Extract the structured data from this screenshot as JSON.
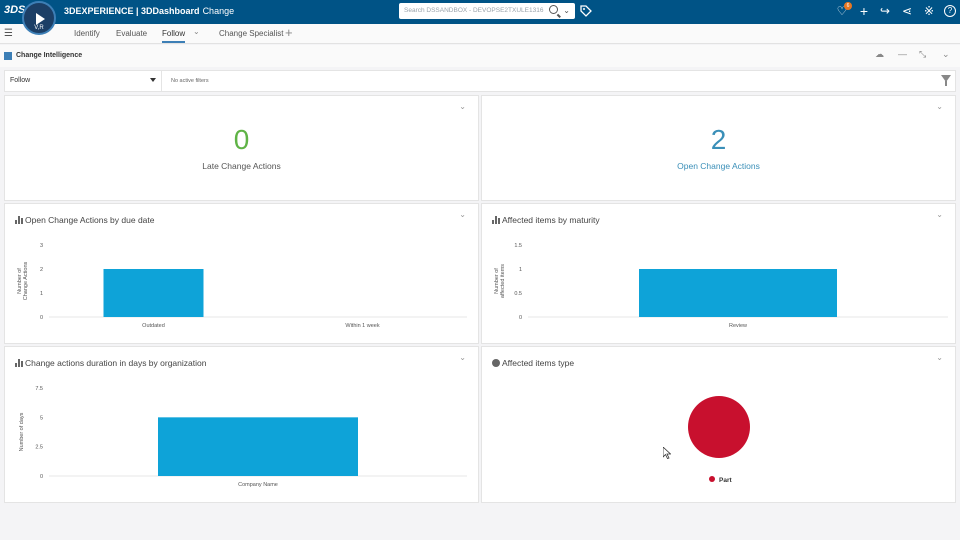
{
  "topbar": {
    "ds_logo": "3DS",
    "compass_label": "V,R",
    "brand_prefix": "3DEXPERIENCE | 3DDashboard",
    "app_name": "Change",
    "search_placeholder": "Search DSSANDBOX - DEVOPSE2TXULE1316",
    "notification_count": "6"
  },
  "tabs": [
    {
      "label": "Identify"
    },
    {
      "label": "Evaluate"
    },
    {
      "label": "Follow",
      "active": true
    },
    {
      "label": "Change Specialist"
    }
  ],
  "widget": {
    "title": "Change Intelligence"
  },
  "filter": {
    "selected": "Follow",
    "status": "No active filters"
  },
  "kpis": {
    "late": {
      "value": "0",
      "label": "Late Change Actions",
      "color": "#5fb346"
    },
    "open": {
      "value": "2",
      "label": "Open Change Actions",
      "color": "#3a8fb8"
    }
  },
  "colors": {
    "topbar": "#005386",
    "bar": "#0ea3d8",
    "pie": "#c8102e"
  },
  "chart_data": [
    {
      "type": "bar",
      "title": "Open Change Actions by due date",
      "categories": [
        "Outdated",
        "Within 1 week"
      ],
      "values": [
        2,
        0
      ],
      "ylabel": "Number of Change Actions",
      "yticks": [
        "0",
        "1",
        "2",
        "3"
      ],
      "ylim": [
        0,
        3
      ]
    },
    {
      "type": "bar",
      "title": "Affected items by maturity",
      "categories": [
        "Review"
      ],
      "values": [
        1
      ],
      "ylabel": "Number of affected items",
      "yticks": [
        "0",
        "0.5",
        "1",
        "1.5"
      ],
      "ylim": [
        0,
        1.5
      ]
    },
    {
      "type": "bar",
      "title": "Change actions duration in days by organization",
      "categories": [
        "Company Name"
      ],
      "values": [
        5
      ],
      "ylabel": "Number of days",
      "yticks": [
        "0",
        "2.5",
        "5",
        "7.5"
      ],
      "ylim": [
        0,
        7.5
      ]
    },
    {
      "type": "pie",
      "title": "Affected items type",
      "categories": [
        "Part"
      ],
      "values": [
        1
      ],
      "legend": "bottom"
    }
  ]
}
